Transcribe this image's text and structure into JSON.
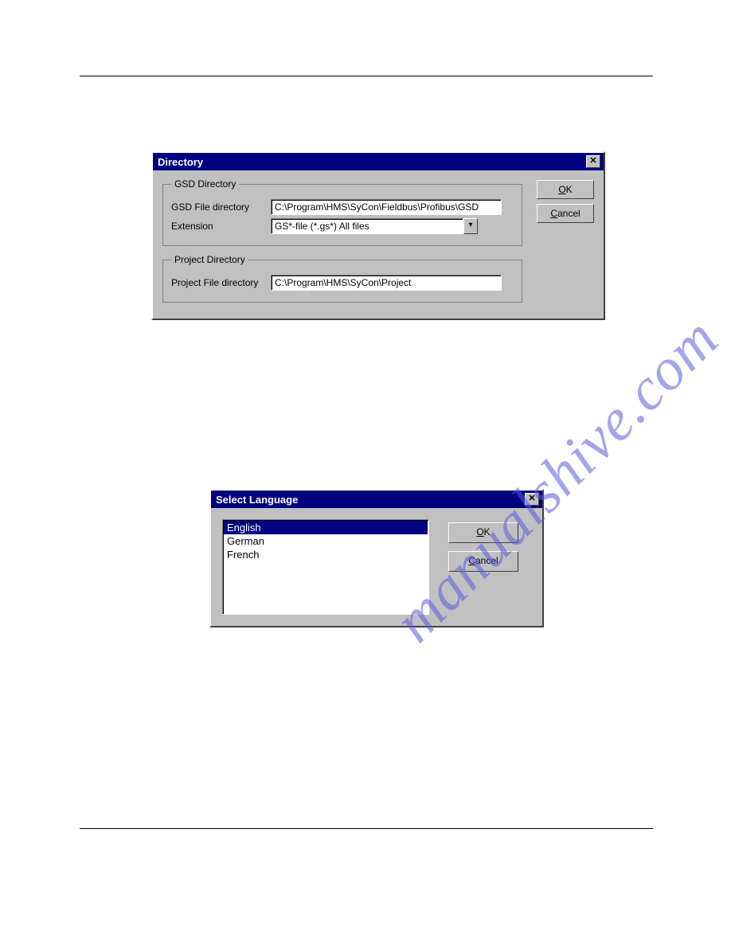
{
  "watermark": "manualshive.com",
  "dialog_directory": {
    "title": "Directory",
    "groups": {
      "gsd": {
        "legend": "GSD Directory",
        "file_label": "GSD File directory",
        "file_value": "C:\\Program\\HMS\\SyCon\\Fieldbus\\Profibus\\GSD",
        "ext_label": "Extension",
        "ext_value": "GS*-file  (*.gs*) All files"
      },
      "project": {
        "legend": "Project Directory",
        "file_label": "Project File directory",
        "file_value": "C:\\Program\\HMS\\SyCon\\Project"
      }
    },
    "buttons": {
      "ok": "OK",
      "cancel": "Cancel"
    }
  },
  "dialog_language": {
    "title": "Select Language",
    "items": [
      "English",
      "German",
      "French"
    ],
    "selected_index": 0,
    "buttons": {
      "ok": "OK",
      "cancel": "Cancel"
    }
  }
}
